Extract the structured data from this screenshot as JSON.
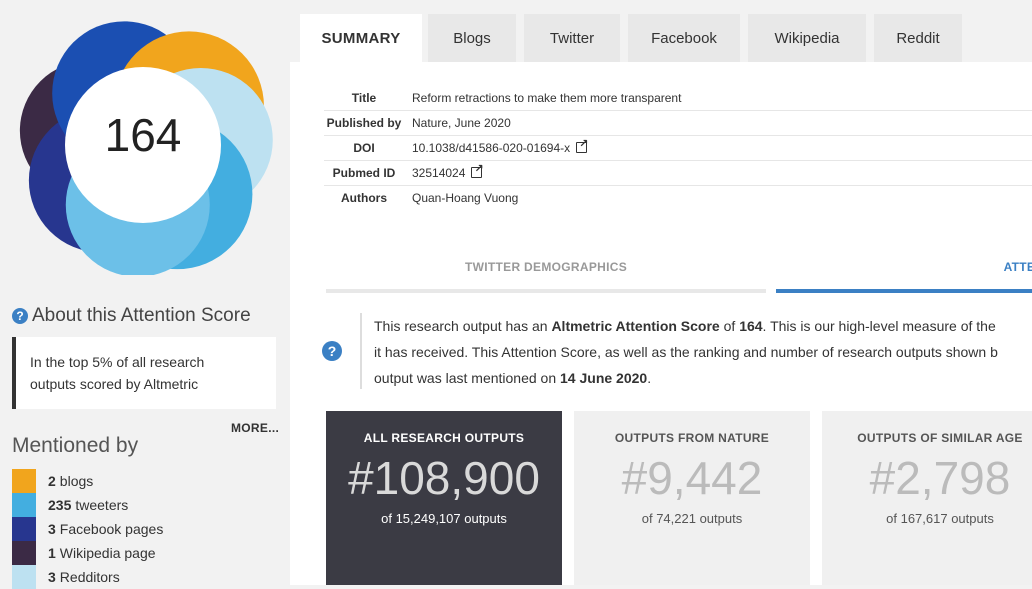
{
  "score": "164",
  "donut_colors": [
    "#f1a51d",
    "#43aee0",
    "#27368f",
    "#3b2a45",
    "#bde1f1",
    "#1b4fb2",
    "#6cc0e8"
  ],
  "about": {
    "title": "About this Attention Score",
    "text_line1": "In the top 5% of all research",
    "text_line2": "outputs scored by Altmetric",
    "more": "MORE..."
  },
  "mentioned_by": {
    "title": "Mentioned by",
    "items": [
      {
        "count": "2",
        "label": "blogs",
        "color": "#f1a51d"
      },
      {
        "count": "235",
        "label": "tweeters",
        "color": "#43aee0"
      },
      {
        "count": "3",
        "label": "Facebook pages",
        "color": "#27368f"
      },
      {
        "count": "1",
        "label": "Wikipedia page",
        "color": "#3b2a45"
      },
      {
        "count": "3",
        "label": "Redditors",
        "color": "#bde1f1"
      }
    ]
  },
  "tabs": [
    "SUMMARY",
    "Blogs",
    "Twitter",
    "Facebook",
    "Wikipedia",
    "Reddit"
  ],
  "meta": {
    "title_label": "Title",
    "title_value": "Reform retractions to make them more transparent",
    "published_label": "Published by",
    "published_value": "Nature, June 2020",
    "doi_label": "DOI",
    "doi_value": "10.1038/d41586-020-01694-x",
    "pubmed_label": "Pubmed ID",
    "pubmed_value": "32514024",
    "authors_label": "Authors",
    "authors_value": "Quan-Hoang Vuong"
  },
  "subtabs": {
    "demographics": "TWITTER DEMOGRAPHICS",
    "attention": "ATTENTION S"
  },
  "description": {
    "l1_a": "This research output has an ",
    "l1_b": "Altmetric Attention Score",
    "l1_c": " of ",
    "l1_d": "164",
    "l1_e": ". This is our high-level measure of the",
    "l2": "it has received. This Attention Score, as well as the ranking and number of research outputs shown b",
    "l3_a": "output was last mentioned on ",
    "l3_b": "14 June 2020",
    "l3_c": "."
  },
  "rank_boxes": [
    {
      "title": "ALL RESEARCH OUTPUTS",
      "rank": "#108,900",
      "of": "of 15,249,107 outputs"
    },
    {
      "title": "OUTPUTS FROM NATURE",
      "rank": "#9,442",
      "of": "of 74,221 outputs"
    },
    {
      "title": "OUTPUTS OF SIMILAR AGE",
      "rank": "#2,798",
      "of": "of 167,617 outputs"
    }
  ]
}
